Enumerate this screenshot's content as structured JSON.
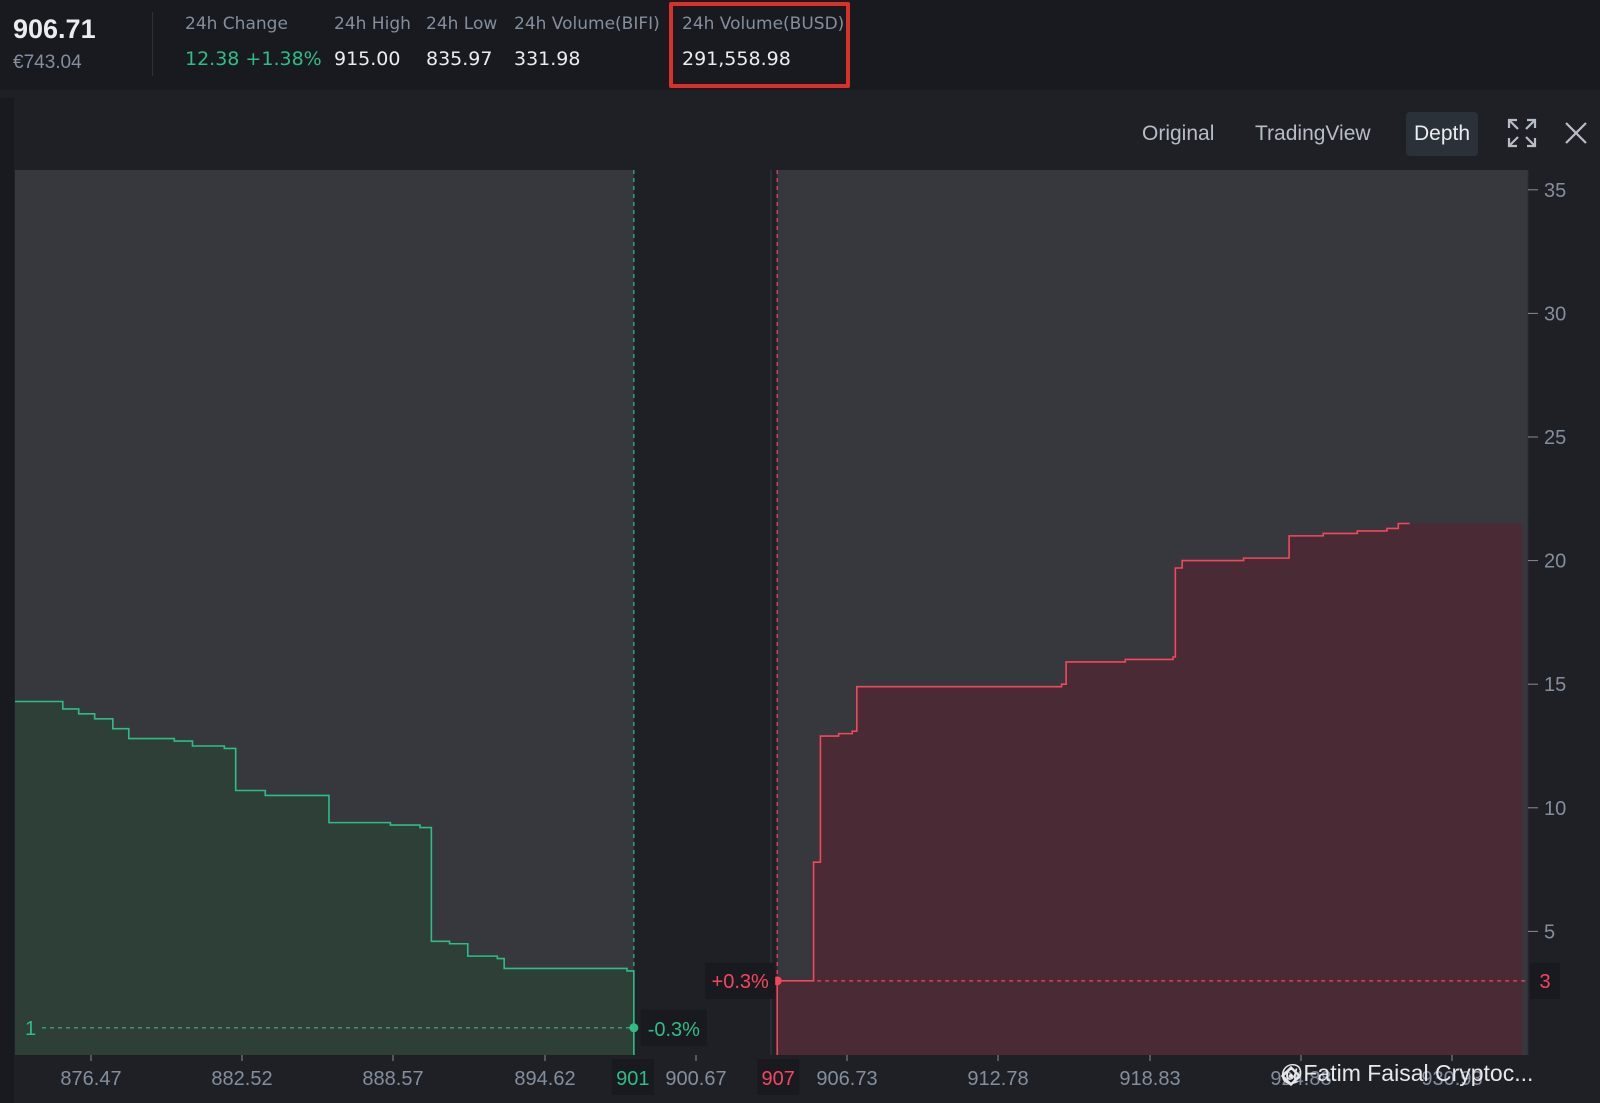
{
  "ticker": {
    "last_price": "906.71",
    "fiat_price": "€743.04",
    "stats": [
      {
        "label": "24h Change",
        "value": "12.38 +1.38%",
        "trend": "up"
      },
      {
        "label": "24h High",
        "value": "915.00",
        "trend": "neutral"
      },
      {
        "label": "24h Low",
        "value": "835.97",
        "trend": "neutral"
      },
      {
        "label": "24h Volume(BIFI)",
        "value": "331.98",
        "trend": "neutral"
      },
      {
        "label": "24h Volume(BUSD)",
        "value": "291,558.98",
        "trend": "neutral",
        "highlighted": true
      }
    ]
  },
  "toolbar": {
    "views": [
      {
        "label": "Original",
        "active": false
      },
      {
        "label": "TradingView",
        "active": false
      },
      {
        "label": "Depth",
        "active": true
      }
    ],
    "fullscreen_icon": "expand-icon",
    "close_icon": "close-icon"
  },
  "chart_data": {
    "type": "area",
    "subtype": "depth",
    "x_ticks": [
      "876.47",
      "882.52",
      "888.57",
      "894.62",
      "900.67",
      "906.73",
      "912.78",
      "918.83",
      "924.88",
      "930.93"
    ],
    "y_ticks": [
      5,
      10,
      15,
      20,
      25,
      30,
      35
    ],
    "ylim": [
      0,
      35.8
    ],
    "xlim": [
      873.5,
      940.0
    ],
    "grid": false,
    "bids": {
      "color": "#2ebd85",
      "fill": "#2e3f38",
      "points": [
        [
          873.5,
          14.3
        ],
        [
          875.0,
          14.3
        ],
        [
          875.6,
          14.0
        ],
        [
          876.3,
          13.8
        ],
        [
          877.0,
          13.6
        ],
        [
          877.8,
          13.2
        ],
        [
          878.5,
          12.8
        ],
        [
          880.5,
          12.7
        ],
        [
          881.3,
          12.5
        ],
        [
          882.7,
          12.4
        ],
        [
          883.2,
          10.7
        ],
        [
          884.5,
          10.5
        ],
        [
          886.5,
          10.5
        ],
        [
          887.3,
          9.4
        ],
        [
          890.0,
          9.3
        ],
        [
          891.3,
          9.2
        ],
        [
          891.8,
          4.6
        ],
        [
          892.6,
          4.5
        ],
        [
          893.4,
          4.0
        ],
        [
          894.7,
          3.9
        ],
        [
          895.0,
          3.5
        ],
        [
          900.4,
          3.4
        ],
        [
          900.7,
          1.1
        ]
      ],
      "best_price": "901",
      "best_price_value": 900.7,
      "depth_label": "1",
      "depth_value": 1.1,
      "pct_label": "-0.3%"
    },
    "asks": {
      "color": "#f6465d",
      "fill": "#4a2a34",
      "points": [
        [
          907.0,
          3.0
        ],
        [
          908.5,
          3.0
        ],
        [
          908.6,
          7.8
        ],
        [
          908.9,
          12.9
        ],
        [
          909.7,
          13.0
        ],
        [
          910.3,
          13.1
        ],
        [
          910.5,
          14.9
        ],
        [
          915.0,
          14.9
        ],
        [
          919.5,
          15.0
        ],
        [
          919.7,
          15.9
        ],
        [
          922.3,
          16.0
        ],
        [
          924.4,
          16.1
        ],
        [
          924.5,
          19.7
        ],
        [
          924.8,
          20.0
        ],
        [
          927.5,
          20.1
        ],
        [
          929.4,
          20.1
        ],
        [
          929.5,
          21.0
        ],
        [
          931.0,
          21.1
        ],
        [
          932.5,
          21.2
        ],
        [
          933.2,
          21.2
        ],
        [
          933.8,
          21.3
        ],
        [
          934.3,
          21.5
        ],
        [
          934.8,
          21.5
        ]
      ],
      "best_price": "907",
      "best_price_value": 907.0,
      "depth_label": "3",
      "depth_value": 3.0,
      "pct_label": "+0.3%"
    }
  },
  "watermark": {
    "text": "@Fatim Faisal Cryptoc..."
  }
}
